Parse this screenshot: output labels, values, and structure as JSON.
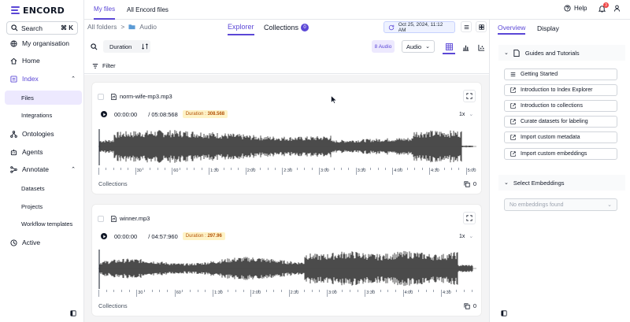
{
  "app": {
    "brand": "ENCORD"
  },
  "sidebar": {
    "search_label": "Search",
    "search_shortcut": "⌘ K",
    "items": [
      {
        "label": "My organisation",
        "icon": "globe-icon"
      },
      {
        "label": "Home",
        "icon": "home-icon"
      },
      {
        "label": "Index",
        "icon": "index-icon"
      },
      {
        "label": "Files"
      },
      {
        "label": "Integrations"
      },
      {
        "label": "Ontologies",
        "icon": "ontology-icon"
      },
      {
        "label": "Agents",
        "icon": "agents-icon"
      },
      {
        "label": "Annotate",
        "icon": "annotate-icon"
      },
      {
        "label": "Datasets"
      },
      {
        "label": "Projects"
      },
      {
        "label": "Workflow templates"
      },
      {
        "label": "Active",
        "icon": "active-icon"
      }
    ]
  },
  "topbar": {
    "tabs": [
      "My files",
      "All Encord files"
    ],
    "help_label": "Help",
    "notification_count": "3"
  },
  "toolbar": {
    "breadcrumb_root": "All folders",
    "breadcrumb_sep": ">",
    "breadcrumb_current": "Audio",
    "tabs": [
      "Explorer",
      "Collections"
    ],
    "collections_count": "0",
    "date_label": "Oct 25, 2024, 11:12 AM",
    "duration_chip": "Duration",
    "count_chip": "8 Audio",
    "type_select": "Audio",
    "filter_label": "Filter"
  },
  "files": [
    {
      "name": "norm-wife-mp3.mp3",
      "current_time": "00:00:00",
      "total_time": "/ 05:08:568",
      "duration_label": "Duration :",
      "duration_value": "308.568",
      "speed": "1x",
      "ruler": [
        "30",
        "60",
        "1:30",
        "2:00",
        "2:30",
        "3:00",
        "3:30",
        "4:00",
        "4:30",
        "5:00"
      ],
      "collections_label": "Collections",
      "collections_count": "0"
    },
    {
      "name": "winner.mp3",
      "current_time": "00:00:00",
      "total_time": "/ 04:57:960",
      "duration_label": "Duration :",
      "duration_value": "297.96",
      "speed": "1x",
      "ruler": [
        "30",
        "60",
        "1:30",
        "2:00",
        "2:30",
        "3:00",
        "3:30",
        "4:00",
        "4:30"
      ],
      "collections_label": "Collections",
      "collections_count": "0"
    }
  ],
  "right_panel": {
    "tabs": [
      "Overview",
      "Display"
    ],
    "guides_title": "Guides and Tutorials",
    "guides": [
      {
        "label": "Getting Started",
        "icon": "list-icon"
      },
      {
        "label": "Introduction to Index Explorer",
        "icon": "external-link-icon"
      },
      {
        "label": "Introduction to collections",
        "icon": "external-link-icon"
      },
      {
        "label": "Curate datasets for labeling",
        "icon": "external-link-icon"
      },
      {
        "label": "Import custom metadata",
        "icon": "external-link-icon"
      },
      {
        "label": "Import custom embeddings",
        "icon": "external-link-icon"
      }
    ],
    "embeddings_title": "Select Embeddings",
    "embeddings_placeholder": "No embeddings found"
  },
  "colors": {
    "accent": "#5b47d6",
    "wave": "#4b4b4b",
    "duration_badge_bg": "#fef3c7"
  }
}
